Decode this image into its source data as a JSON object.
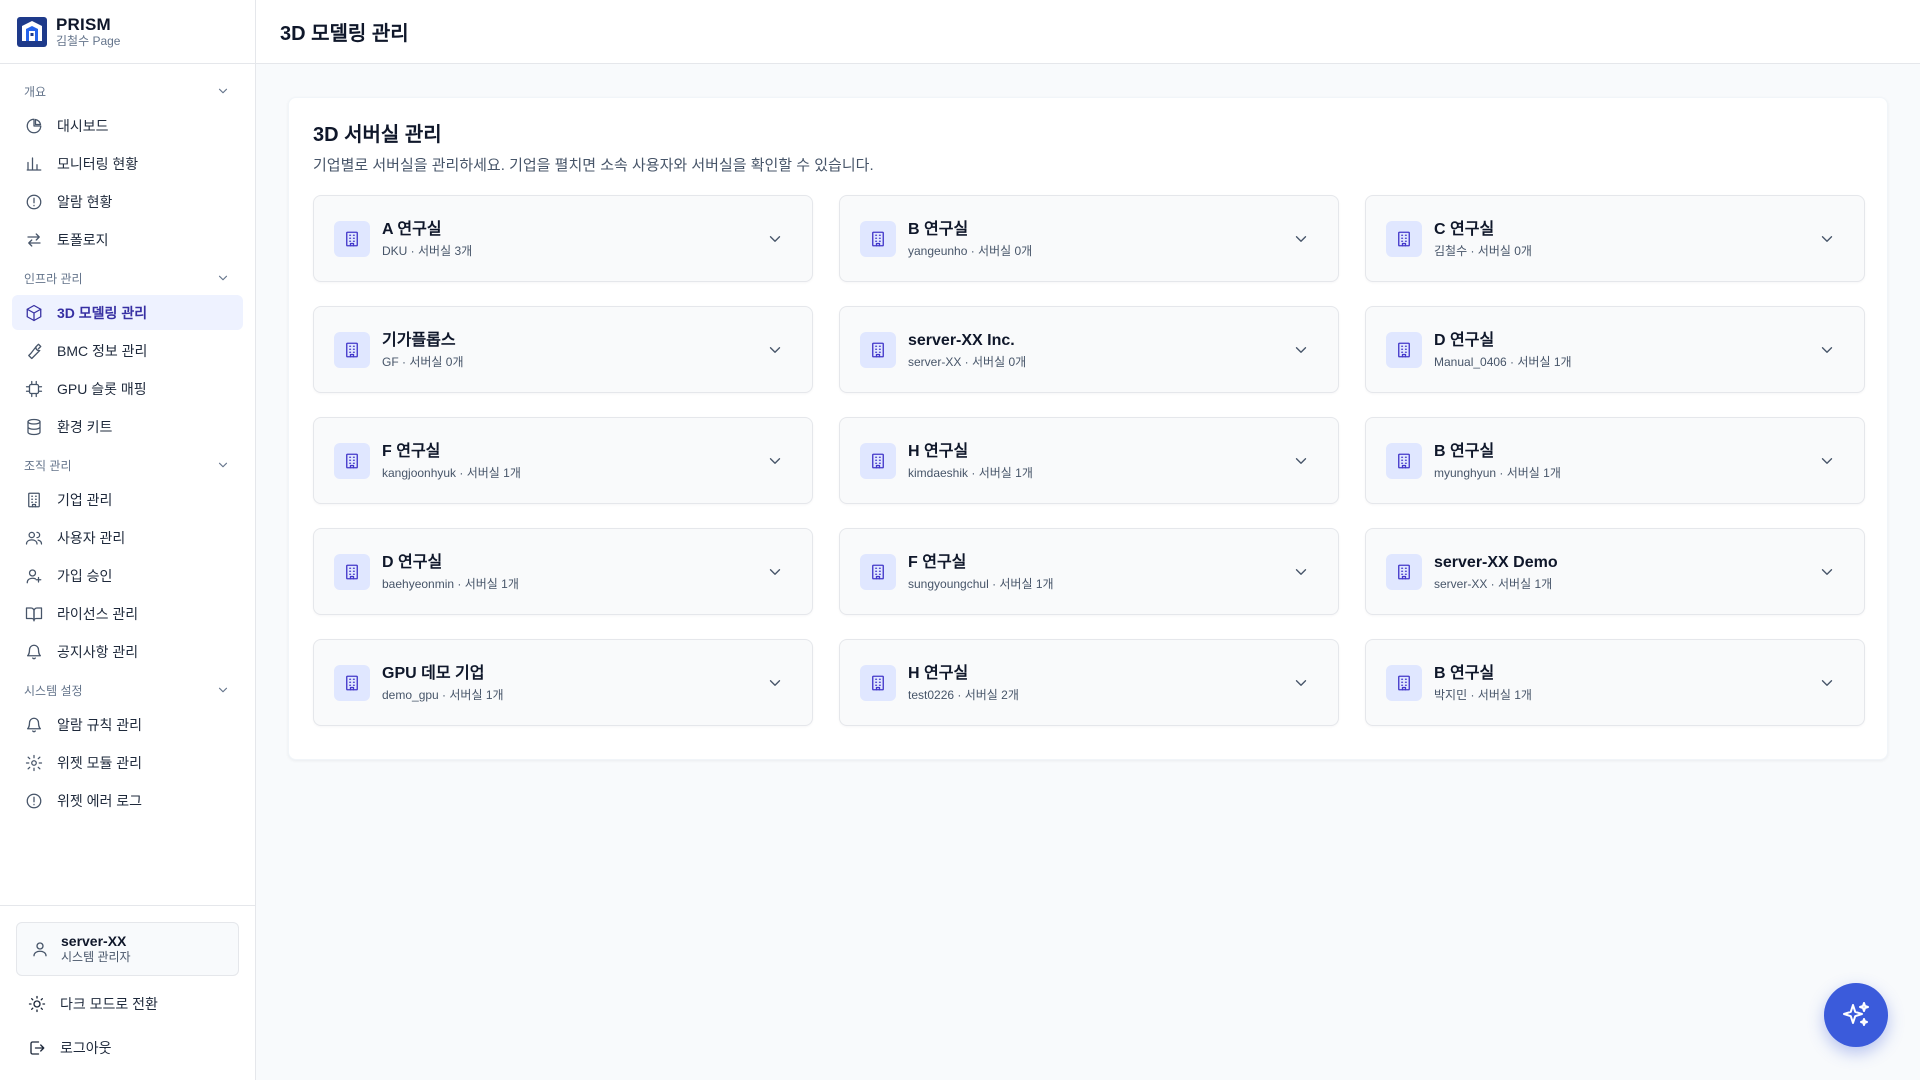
{
  "brand": {
    "name": "PRISM",
    "sub": "김철수 Page"
  },
  "header": {
    "title": "3D 모델링 관리"
  },
  "sidebar": {
    "sections": [
      {
        "label": "개요",
        "items": [
          {
            "label": "대시보드",
            "icon": "pie-chart-icon"
          },
          {
            "label": "모니터링 현황",
            "icon": "bar-chart-icon"
          },
          {
            "label": "알람 현황",
            "icon": "alert-circle-icon"
          },
          {
            "label": "토폴로지",
            "icon": "arrows-icon"
          }
        ]
      },
      {
        "label": "인프라 관리",
        "items": [
          {
            "label": "3D 모델링 관리",
            "icon": "box-icon",
            "active": true
          },
          {
            "label": "BMC 정보 관리",
            "icon": "wrench-icon"
          },
          {
            "label": "GPU 슬롯 매핑",
            "icon": "cpu-icon"
          },
          {
            "label": "환경 키트",
            "icon": "database-icon"
          }
        ]
      },
      {
        "label": "조직 관리",
        "items": [
          {
            "label": "기업 관리",
            "icon": "building-icon"
          },
          {
            "label": "사용자 관리",
            "icon": "users-icon"
          },
          {
            "label": "가입 승인",
            "icon": "user-plus-icon"
          },
          {
            "label": "라이선스 관리",
            "icon": "book-icon"
          },
          {
            "label": "공지사항 관리",
            "icon": "bell-icon"
          }
        ]
      },
      {
        "label": "시스템 설정",
        "items": [
          {
            "label": "알람 규칙 관리",
            "icon": "bell-icon"
          },
          {
            "label": "위젯 모듈 관리",
            "icon": "gear-icon"
          },
          {
            "label": "위젯 에러 로그",
            "icon": "alert-circle-icon"
          }
        ]
      }
    ]
  },
  "user": {
    "name": "server-XX",
    "role": "시스템 관리자"
  },
  "footer": {
    "dark_mode": "다크 모드로 전환",
    "logout": "로그아웃"
  },
  "panel": {
    "title": "3D 서버실 관리",
    "description": "기업별로 서버실을 관리하세요. 기업을 펼치면 소속 사용자와 서버실을 확인할 수 있습니다."
  },
  "companies": [
    {
      "name": "A 연구실",
      "meta": "DKU · 서버실 3개"
    },
    {
      "name": "B 연구실",
      "meta": "yangeunho · 서버실 0개"
    },
    {
      "name": "C 연구실",
      "meta": "김철수 · 서버실 0개"
    },
    {
      "name": "기가플롭스",
      "meta": "GF · 서버실 0개"
    },
    {
      "name": "server-XX Inc.",
      "meta": "server-XX · 서버실 0개"
    },
    {
      "name": "D 연구실",
      "meta": "Manual_0406 · 서버실 1개"
    },
    {
      "name": "F 연구실",
      "meta": "kangjoonhyuk · 서버실 1개"
    },
    {
      "name": "H 연구실",
      "meta": "kimdaeshik · 서버실 1개"
    },
    {
      "name": "B 연구실",
      "meta": "myunghyun · 서버실 1개"
    },
    {
      "name": "D 연구실",
      "meta": "baehyeonmin · 서버실 1개"
    },
    {
      "name": "F 연구실",
      "meta": "sungyoungchul · 서버실 1개"
    },
    {
      "name": "server-XX Demo",
      "meta": "server-XX · 서버실 1개"
    },
    {
      "name": "GPU 데모 기업",
      "meta": "demo_gpu · 서버실 1개"
    },
    {
      "name": "H 연구실",
      "meta": "test0226 · 서버실 2개"
    },
    {
      "name": "B 연구실",
      "meta": "박지민 · 서버실 1개"
    }
  ],
  "fab": {
    "icon": "sparkles-icon"
  },
  "colors": {
    "accent": "#3b5bdb",
    "active_bg": "#eef2ff",
    "active_text": "#3730a3",
    "icon_bg": "#e0e7ff"
  }
}
